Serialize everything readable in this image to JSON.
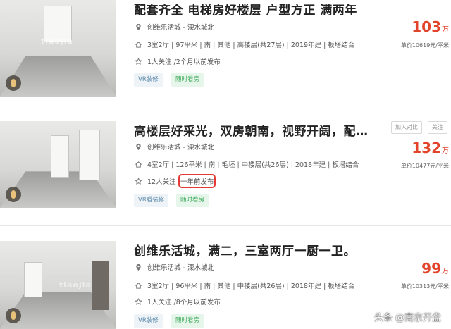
{
  "colors": {
    "price": "#e2432b",
    "tag_vr_bg": "#eef3f7",
    "tag_vr_text": "#5a87a8",
    "tag_visit_bg": "#e7f6ea",
    "tag_visit_text": "#3aa85a",
    "highlight": "#e53935"
  },
  "icons": {
    "location": "location-pin-icon",
    "house": "house-icon",
    "favorite": "star-icon",
    "vr": "vr-badge-icon"
  },
  "listings": [
    {
      "title": "配套齐全 电梯房好楼层 户型方正 满两年",
      "community": "创维乐活城 - 溧水城北",
      "details": "3室2厅 | 97平米 | 南 | 其他 | 高楼层(共27层) | 2019年建 | 板塔结合",
      "meta_follow": "1人关注 / ",
      "meta_time": "2个月以前发布",
      "tag_vr": "VR装修",
      "tag_visit": "随时看房",
      "price_value": "103",
      "price_unit": "万",
      "unit_price": "单价10619元/平米"
    },
    {
      "title": "高楼层好采光，双房朝南，视野开阔，配…",
      "community": "创维乐活城 - 溧水城北",
      "details": "4室2厅 | 126平米 | 南 | 毛坯 | 中楼层(共26层) | 2018年建 | 板塔结合",
      "meta_follow": "12人关注 / ",
      "meta_time": "一年前发布",
      "tag_vr": "VR看装修",
      "tag_visit": "随时看房",
      "price_value": "132",
      "price_unit": "万",
      "unit_price": "单价10477元/平米",
      "compare_label": "加入对比",
      "follow_label": "关注"
    },
    {
      "title": "创维乐活城，满二，三室两厅一厨一卫。",
      "community": "创维乐活城 - 溧水城北",
      "details": "3室2厅 | 96平米 | 南 | 其他 | 中楼层(共26层) | 2018年建 | 板塔结合",
      "meta_follow": "1人关注 / ",
      "meta_time": "8个月以前发布",
      "tag_vr": "VR装修",
      "tag_visit": "随时看房",
      "price_value": "99",
      "price_unit": "万",
      "unit_price": "单价10313元/平米"
    }
  ],
  "photo_watermark": "tiaojia",
  "source_mark": "头条 @南京开盘"
}
